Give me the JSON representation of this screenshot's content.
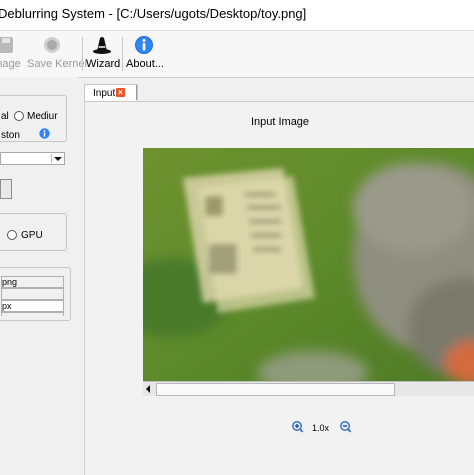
{
  "window": {
    "title": "Deblurring System - [C:/Users/ugots/Desktop/toy.png]"
  },
  "toolbar": {
    "items": [
      {
        "label": "mage",
        "icon": "save-image-icon",
        "enabled": false
      },
      {
        "label": "Save Kernel",
        "icon": "save-kernel-icon",
        "enabled": false
      },
      {
        "label": "Wizard",
        "icon": "wizard-hat-icon",
        "enabled": true
      },
      {
        "label": "About...",
        "icon": "info-icon",
        "enabled": true
      }
    ]
  },
  "left_panel": {
    "mode_group": {
      "option_a_label": "al",
      "option_b_label": "Mediur",
      "option_c_label": "ston",
      "info_icon": "info-icon"
    },
    "combo_value": "",
    "device_group": {
      "gpu_label": "GPU"
    },
    "info_fields": [
      {
        "value": "png"
      },
      {
        "value": ""
      },
      {
        "value": "px"
      },
      {
        "value": ""
      }
    ]
  },
  "tabs": [
    {
      "label": "Input",
      "close_icon": "close-icon"
    }
  ],
  "viewer": {
    "title": "Input Image",
    "zoom_label": "1.0x",
    "zoom_in_icon": "zoom-in-icon",
    "zoom_out_icon": "zoom-out-icon"
  }
}
